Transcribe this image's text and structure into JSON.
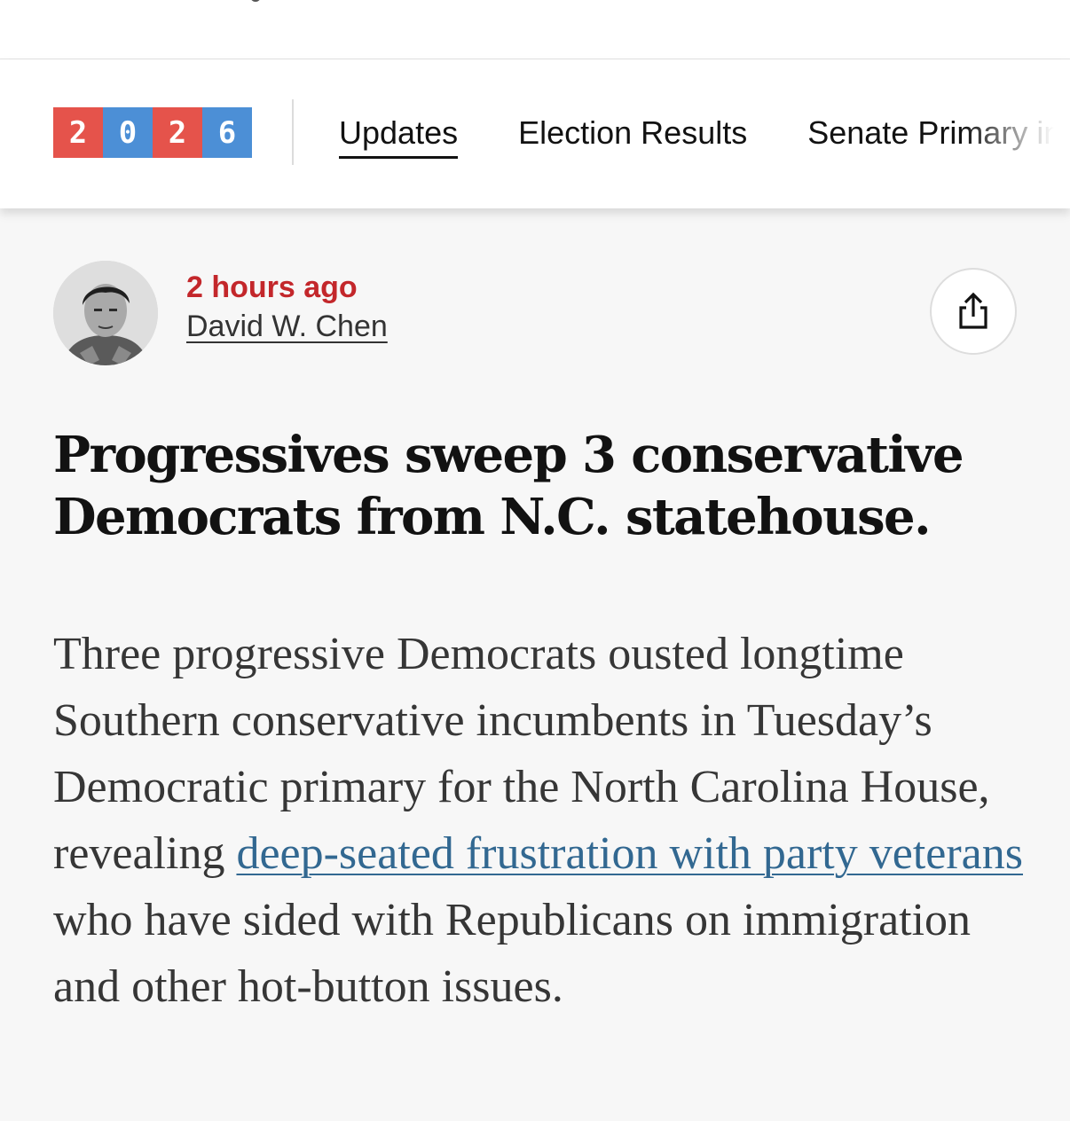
{
  "nav": {
    "logo_digits": [
      "2",
      "0",
      "2",
      "6"
    ],
    "tabs": [
      {
        "label": "Updates",
        "active": true
      },
      {
        "label": "Election Results",
        "active": false
      },
      {
        "label": "Senate Primary in",
        "active": false
      }
    ]
  },
  "byline": {
    "timestamp": "2 hours ago",
    "author": "David W. Chen",
    "share_icon": "share-icon"
  },
  "article": {
    "headline": "Progressives sweep 3 conservative Democrats from N.C. statehouse.",
    "summary_before_link": "Three progressive Democrats ousted longtime Southern conservative incumbents in Tuesday’s Democratic primary for the North Carolina House, revealing ",
    "summary_link": "deep-seated frustration with party veterans",
    "summary_after_link": " who have sided with Republicans on immigration and other hot-button issues."
  },
  "colors": {
    "logo_red": "#e5534b",
    "logo_blue": "#4c8fd6",
    "timestamp": "#c3272b",
    "link": "#326891"
  }
}
